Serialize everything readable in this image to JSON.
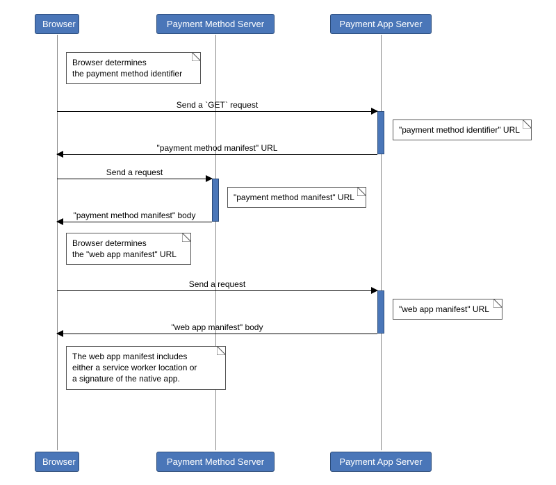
{
  "participants": {
    "browser": "Browser",
    "pm_server": "Payment Method Server",
    "pa_server": "Payment App Server"
  },
  "notes": {
    "n1_line1": "Browser determines",
    "n1_line2": "the payment method identifier",
    "n2": "\"payment method identifier\" URL",
    "n3": "\"payment method manifest\" URL",
    "n4_line1": "Browser determines",
    "n4_line2": "the \"web app manifest\" URL",
    "n5": "\"web app manifest\" URL",
    "n6_line1": "The web app manifest includes",
    "n6_line2": "either a service worker location or",
    "n6_line3": "a signature of the native app."
  },
  "messages": {
    "m1": "Send a `GET` request",
    "m2": "\"payment method manifest\" URL",
    "m3": "Send a request",
    "m4": "\"payment method manifest\" body",
    "m5": "Send a request",
    "m6": "\"web app manifest\" body"
  }
}
